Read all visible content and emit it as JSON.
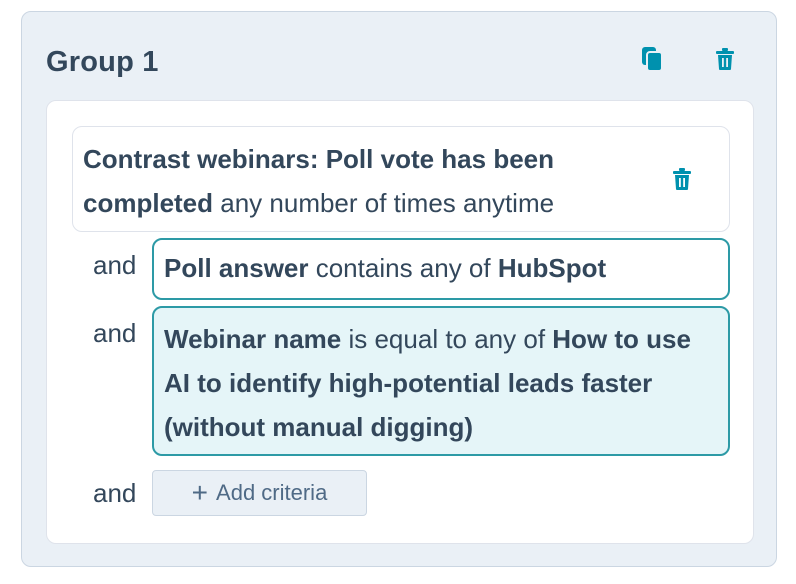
{
  "group": {
    "title": "Group 1",
    "copy_icon": "copy-icon",
    "delete_icon": "trash-icon"
  },
  "main_criterion": {
    "prefix_bold": "Contrast webinars: Poll vote has been completed",
    "suffix": " any number of times anytime",
    "delete_icon": "trash-icon"
  },
  "criteria": [
    {
      "conjunction": "and",
      "property": "Poll answer",
      "operator": " contains any of ",
      "value": "HubSpot"
    },
    {
      "conjunction": "and",
      "property": "Webinar name",
      "operator": " is equal to any of ",
      "value": "How to use AI to identify high-potential leads faster (without manual digging)"
    }
  ],
  "add_row": {
    "conjunction": "and",
    "label": "Add criteria"
  },
  "colors": {
    "accent": "#0091ae",
    "selected_border": "#2d9aa6",
    "selected_bg": "#e5f5f8",
    "text": "#33475b"
  }
}
